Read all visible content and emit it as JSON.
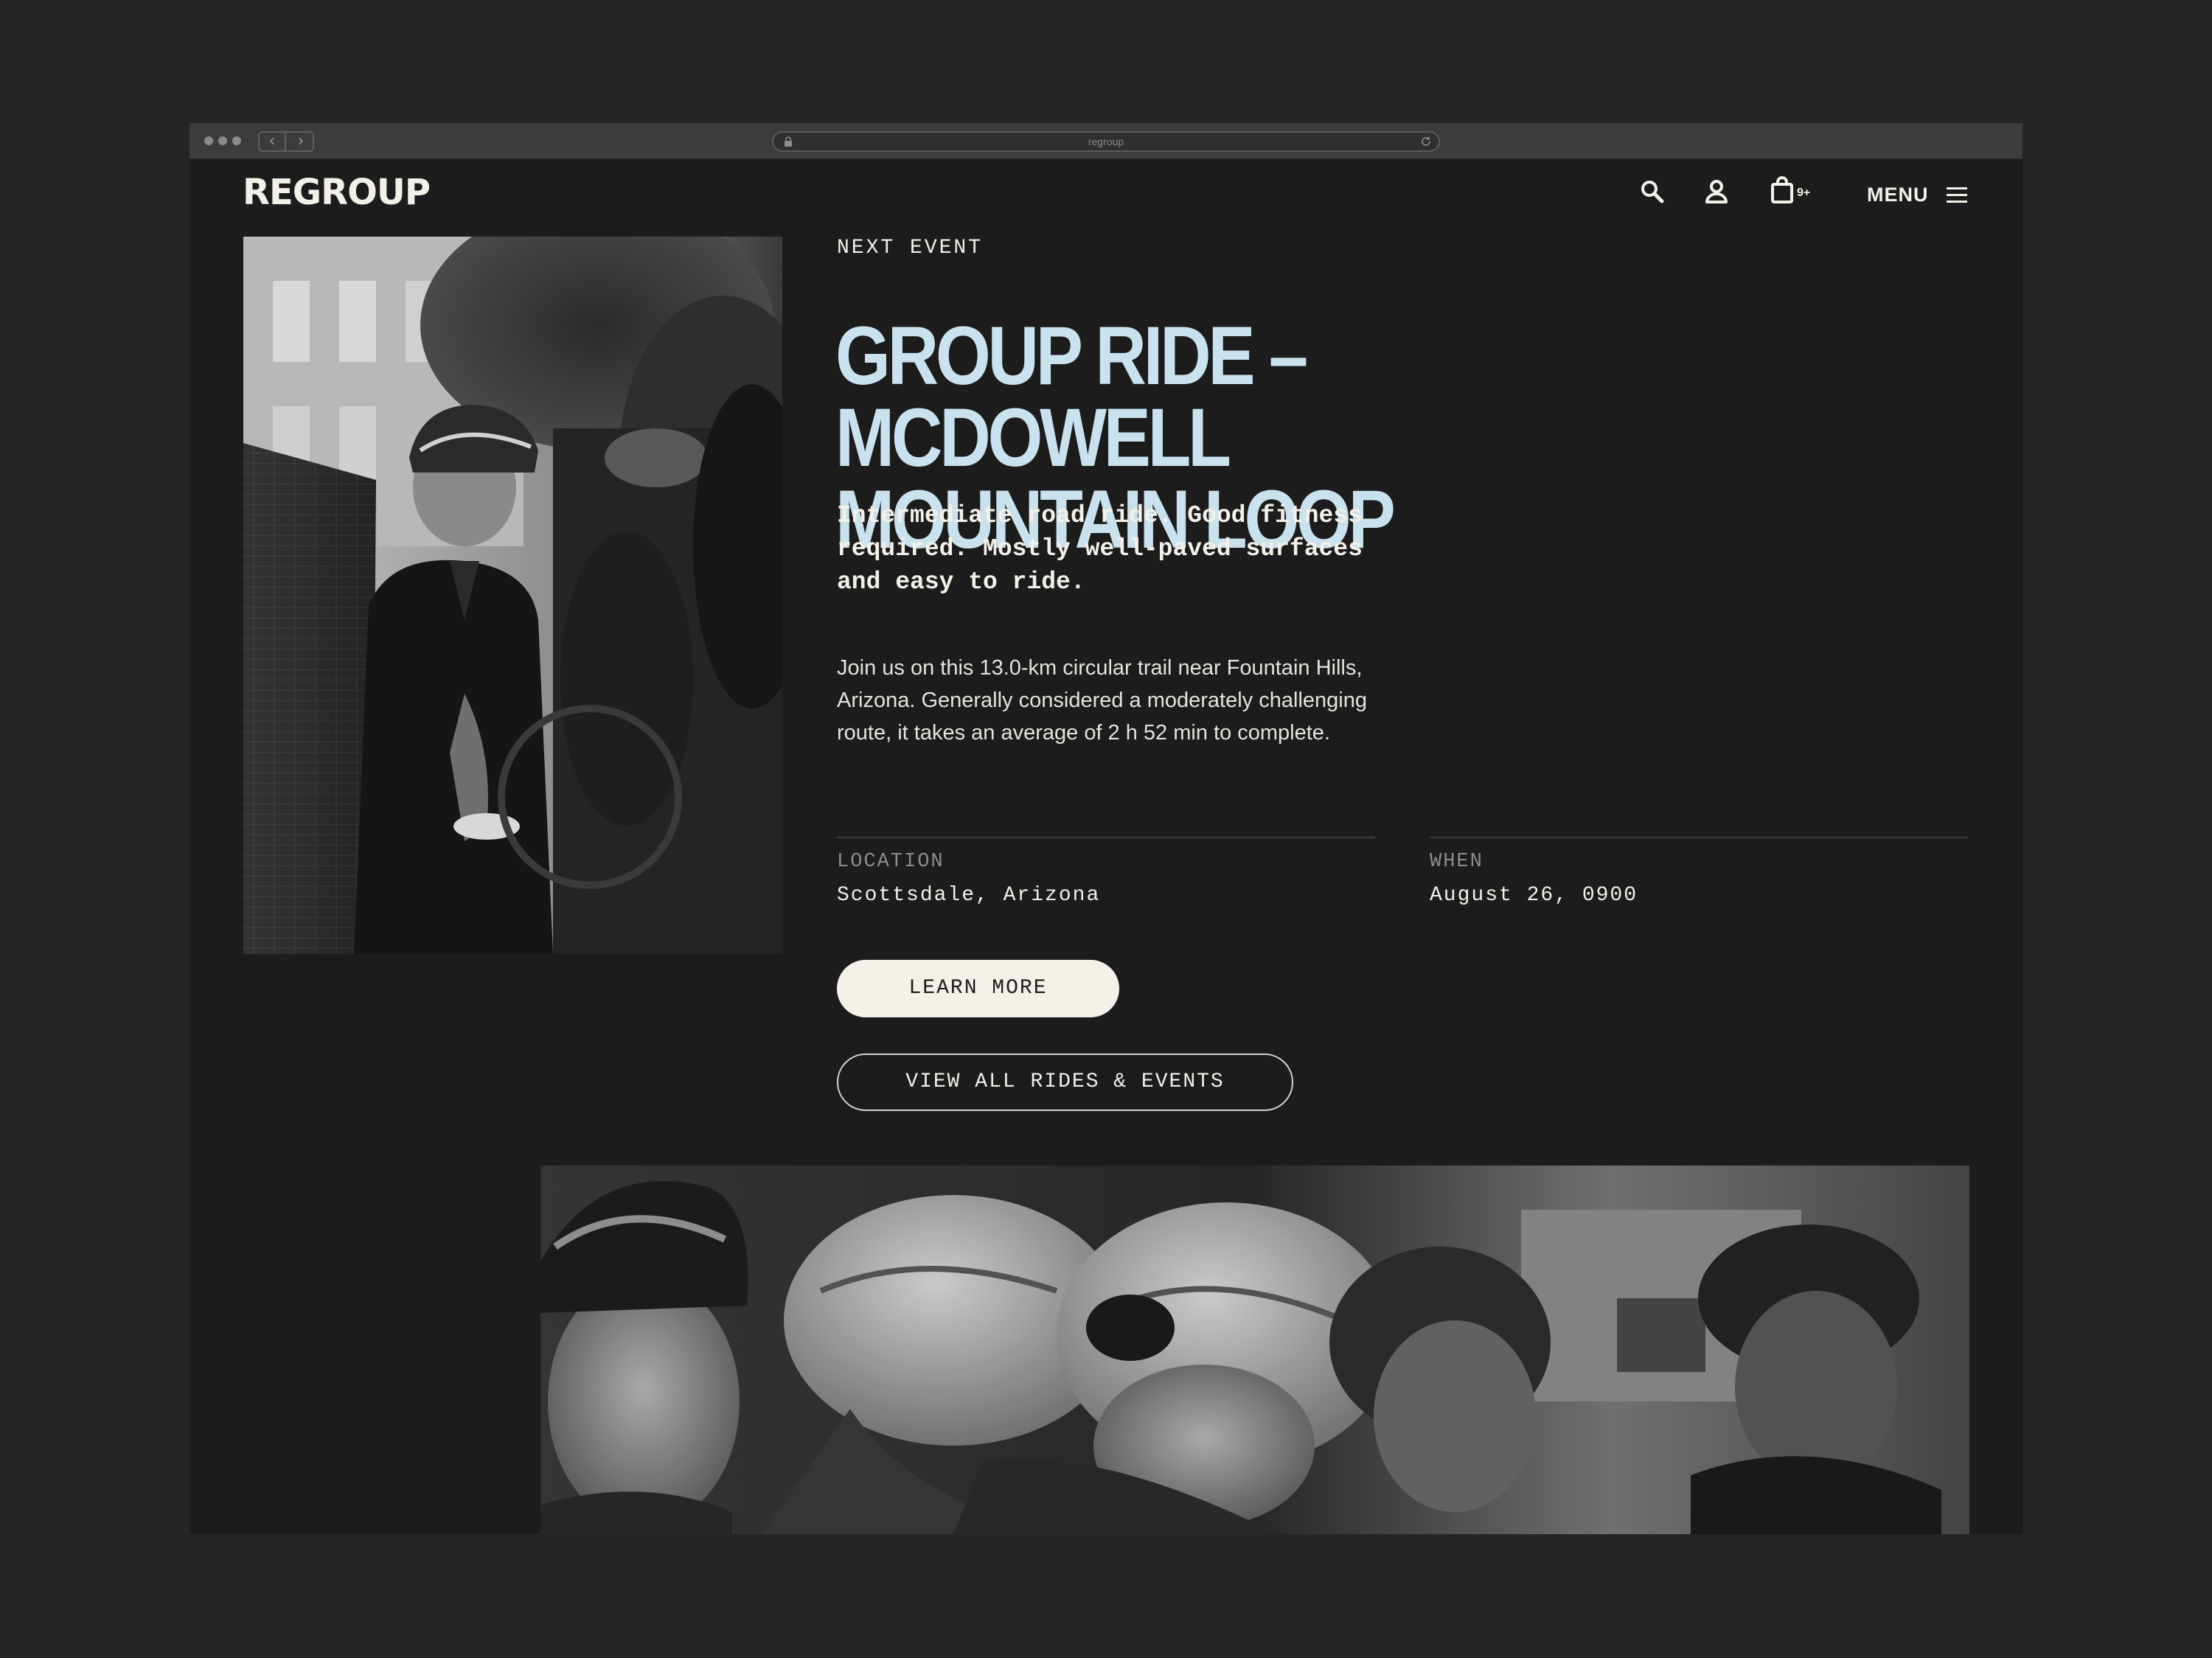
{
  "browser": {
    "url": "regroup"
  },
  "header": {
    "logo": "REGROUP",
    "cart_count": "9+",
    "menu_label": "MENU"
  },
  "event": {
    "eyebrow": "NEXT EVENT",
    "title_line1": "GROUP RIDE – MCDOWELL",
    "title_line2": "MOUNTAIN LOOP",
    "summary": "Intermediate road ride. Good fitness required. Mostly well-paved surfaces and easy to ride.",
    "description": "Join us on this 13.0-km circular trail near Fountain Hills, Arizona. Generally considered a moderately challenging route, it takes an average of 2 h 52 min to complete.",
    "location_label": "LOCATION",
    "location_value": "Scottsdale, Arizona",
    "when_label": "WHEN",
    "when_value": "August 26, 0900",
    "learn_more": "LEARN MORE",
    "view_all": "VIEW ALL RIDES & EVENTS"
  },
  "icons": {
    "search": "search-icon",
    "account": "user-icon",
    "cart": "shopping-bag-icon",
    "menu": "hamburger-icon"
  },
  "colors": {
    "background": "#1c1c1c",
    "title": "#c9e2ee",
    "text": "#f3f0e8",
    "button_fill": "#f5f1e8"
  }
}
